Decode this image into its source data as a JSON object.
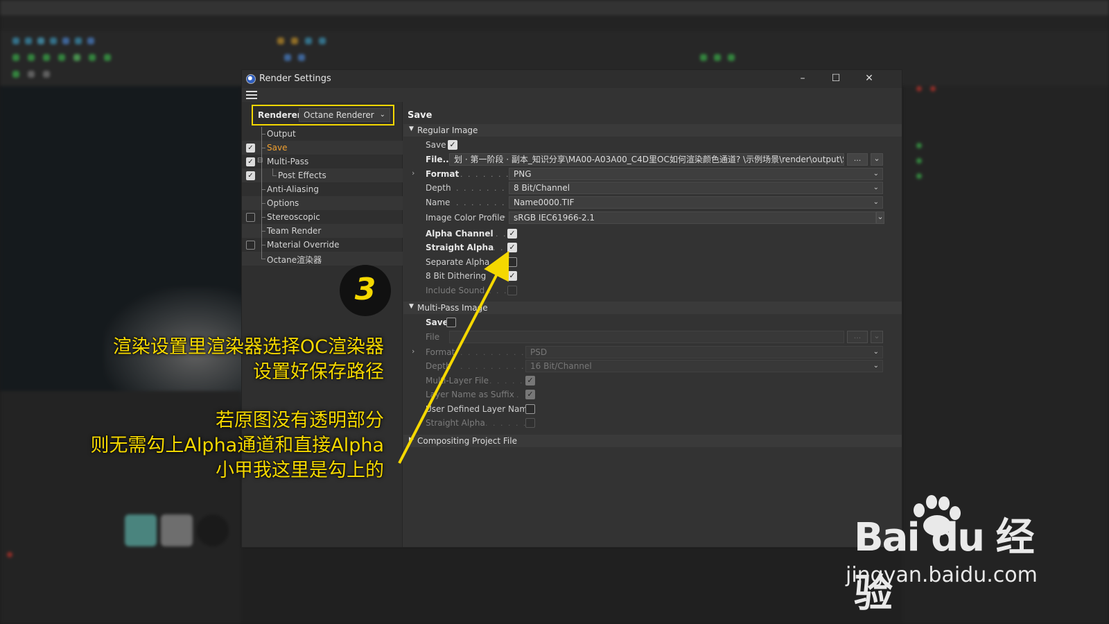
{
  "dialog": {
    "title": "Render Settings",
    "controls": {
      "minimize": "–",
      "maximize": "☐",
      "close": "✕"
    }
  },
  "renderer": {
    "label": "Renderer",
    "value": "Octane Renderer"
  },
  "tree": [
    {
      "label": "Output",
      "checkbox": null,
      "active": false
    },
    {
      "label": "Save",
      "checkbox": true,
      "active": true
    },
    {
      "label": "Multi-Pass",
      "checkbox": true,
      "active": false
    },
    {
      "label": "Post Effects",
      "checkbox": true,
      "active": false
    },
    {
      "label": "Anti-Aliasing",
      "checkbox": null,
      "active": false
    },
    {
      "label": "Options",
      "checkbox": null,
      "active": false
    },
    {
      "label": "Stereoscopic",
      "checkbox": false,
      "active": false
    },
    {
      "label": "Team Render",
      "checkbox": null,
      "active": false
    },
    {
      "label": "Material Override",
      "checkbox": false,
      "active": false
    },
    {
      "label": "Octane渲染器",
      "checkbox": null,
      "active": false
    }
  ],
  "save_panel": {
    "title": "Save",
    "regular_image": {
      "header": "Regular Image",
      "save_label": "Save",
      "save_checked": true,
      "file_label": "File...",
      "file_path": "划 · 第一阶段 · 副本_知识分享\\MA00-A03A00_C4D里OC如何渲染颜色通道? \\示例场景\\render\\output\\Scene",
      "browse_label": "...",
      "format_label": "Format",
      "format_value": "PNG",
      "depth_label": "Depth",
      "depth_value": "8 Bit/Channel",
      "name_label": "Name",
      "name_value": "Name0000.TIF",
      "profile_label": "Image Color Profile",
      "profile_value": "sRGB IEC61966-2.1",
      "alpha_channel_label": "Alpha Channel",
      "alpha_channel_checked": true,
      "straight_alpha_label": "Straight Alpha",
      "straight_alpha_checked": true,
      "separate_alpha_label": "Separate Alpha",
      "separate_alpha_checked": false,
      "dithering_label": "8 Bit Dithering",
      "dithering_checked": true,
      "include_sound_label": "Include Sound",
      "include_sound_checked": false
    },
    "multipass_image": {
      "header": "Multi-Pass Image",
      "save_label": "Save",
      "save_checked": false,
      "file_label": "File",
      "browse_label": "...",
      "format_label": "Format",
      "format_value": "PSD",
      "depth_label": "Depth",
      "depth_value": "16 Bit/Channel",
      "multilayer_label": "Multi-Layer File",
      "multilayer_checked": true,
      "layer_suffix_label": "Layer Name as Suffix",
      "layer_suffix_checked": true,
      "user_layer_label": "User Defined Layer Name",
      "user_layer_checked": false,
      "straight_alpha_label": "Straight Alpha",
      "straight_alpha_checked": false
    },
    "compositing": {
      "header": "Compositing Project File"
    }
  },
  "annotations": {
    "step_number": "3",
    "note1_line1": "渲染设置里渲染器选择OC渲染器",
    "note1_line2": "设置好保存路径",
    "note2_line1": "若原图没有透明部分",
    "note2_line2": "则无需勾上Alpha通道和直接Alpha",
    "note2_line3": "小甲我这里是勾上的",
    "accent_color": "#f5d800"
  },
  "watermark": {
    "logo": "Bai du 经验",
    "url": "jingyan.baidu.com"
  }
}
